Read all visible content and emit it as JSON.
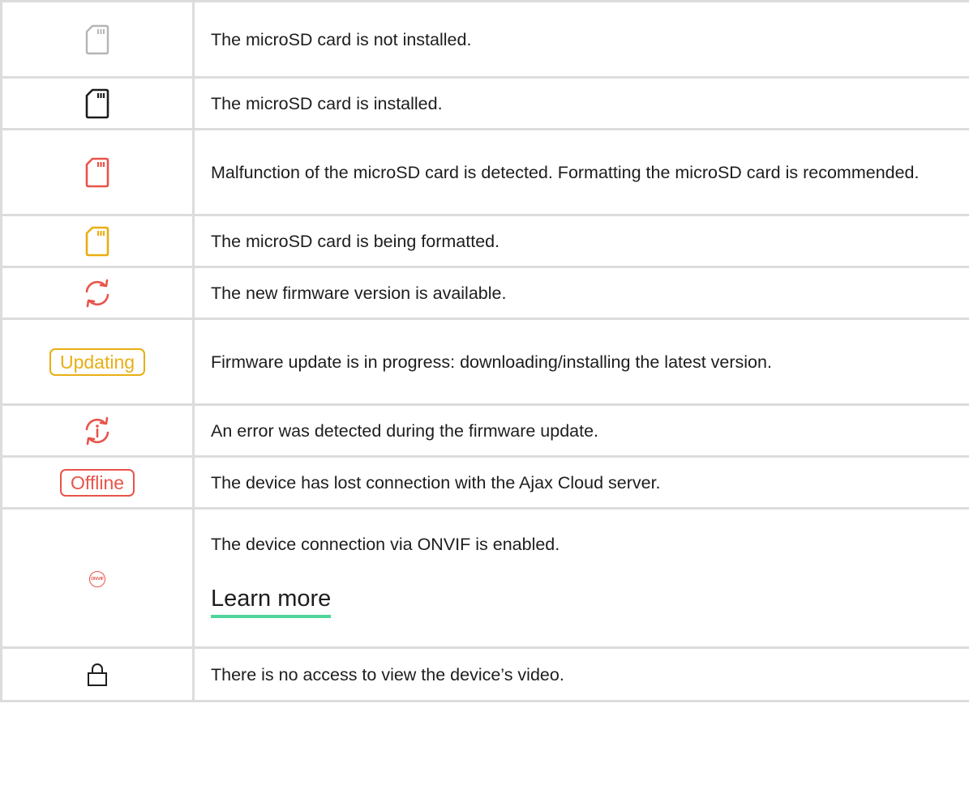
{
  "colors": {
    "grid": "#dcdcdc",
    "gray_icon": "#b5b5b5",
    "dark_icon": "#1d1d1d",
    "red": "#e8544a",
    "yellow": "#e9ae14",
    "link_underline": "#4fd59a"
  },
  "rows": [
    {
      "icon": "microsd-card-gray-icon",
      "text": "The microSD card is not installed."
    },
    {
      "icon": "microsd-card-dark-icon",
      "text": "The microSD card is installed."
    },
    {
      "icon": "microsd-card-red-icon",
      "text": "Malfunction of the microSD card is detected. Formatting the microSD card is recommended."
    },
    {
      "icon": "microsd-card-yellow-icon",
      "text": "The microSD card is being formatted."
    },
    {
      "icon": "refresh-arrows-icon",
      "text": "The new firmware version is available."
    },
    {
      "icon": "updating-badge",
      "badge": "Updating",
      "text": "Firmware update is in progress: downloading/installing the latest version."
    },
    {
      "icon": "refresh-info-icon",
      "text": "An error was detected during the firmware update."
    },
    {
      "icon": "offline-badge",
      "badge": "Offline",
      "text": "The device has lost connection with the Ajax Cloud server."
    },
    {
      "icon": "onvif-icon",
      "badge": "ONVIF",
      "text": "The device connection via ONVIF is enabled.",
      "link": "Learn more"
    },
    {
      "icon": "lock-icon",
      "text": "There is no access to view the device’s video."
    }
  ]
}
